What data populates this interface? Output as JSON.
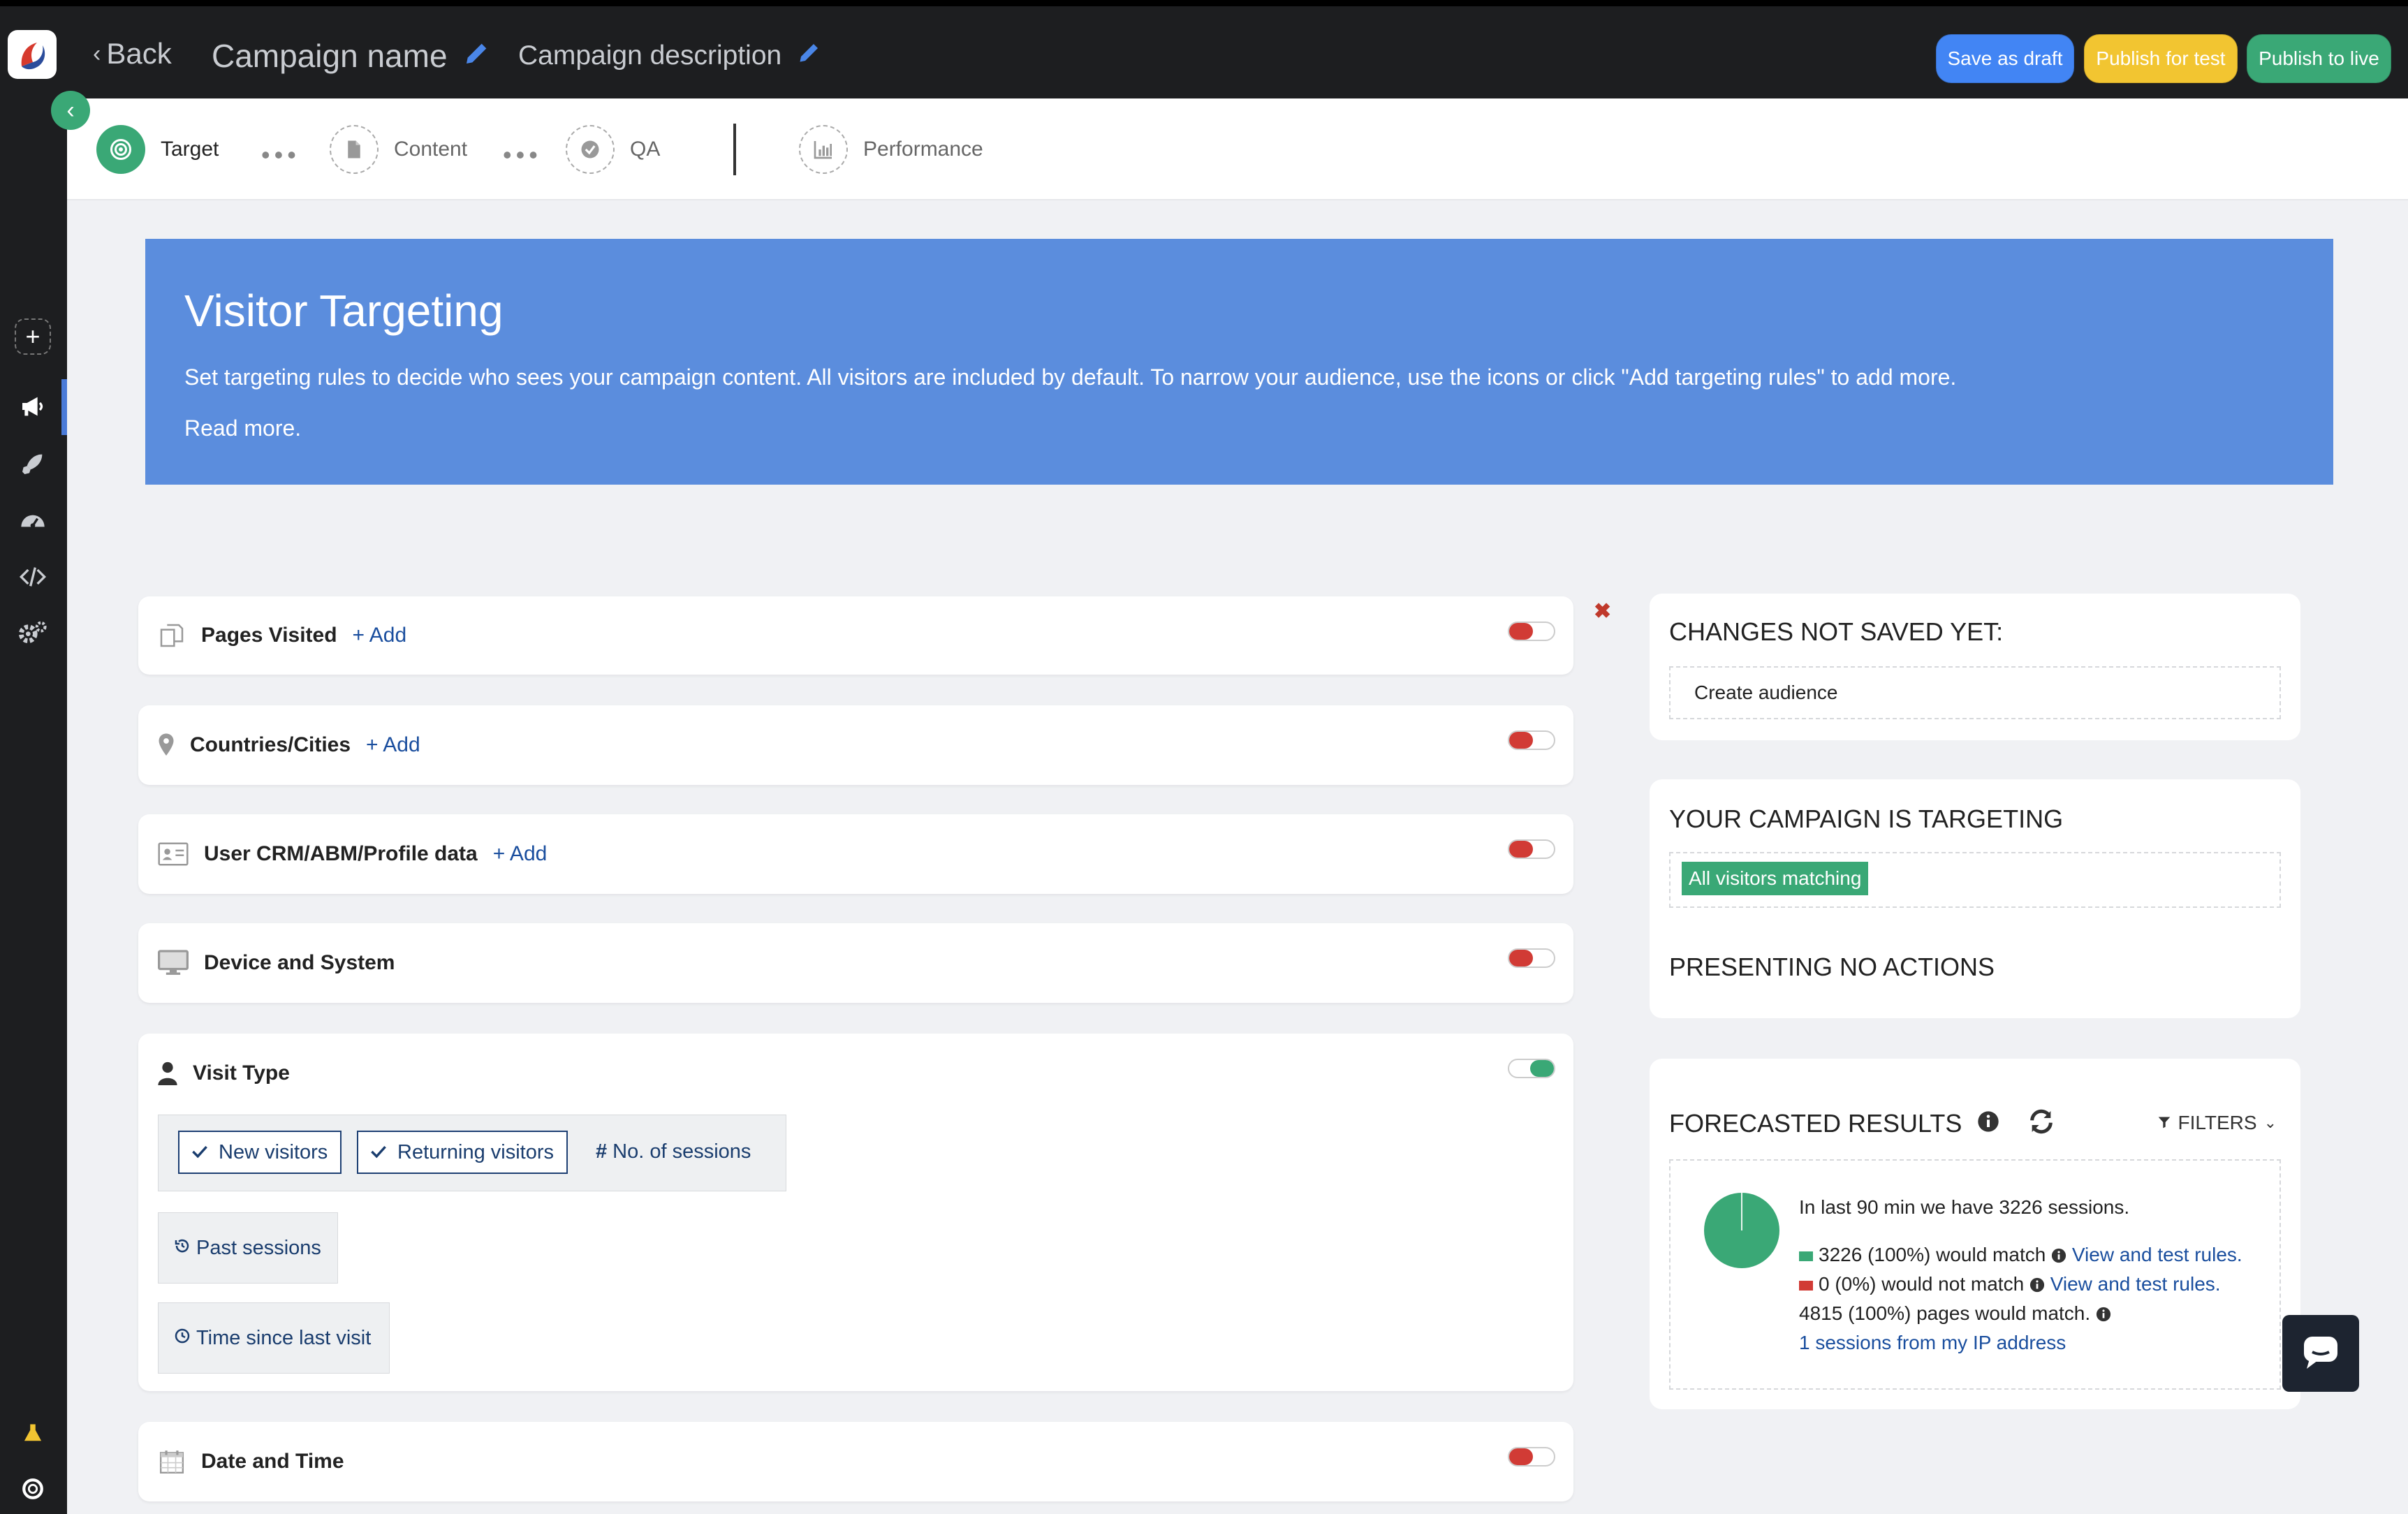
{
  "header": {
    "back_label": "Back",
    "campaign_name": "Campaign name",
    "campaign_description": "Campaign description",
    "buttons": {
      "save_draft": "Save as draft",
      "publish_test": "Publish for test",
      "publish_live": "Publish to live"
    }
  },
  "stepper": {
    "steps": [
      {
        "label": "Target",
        "icon": "target-icon",
        "active": true
      },
      {
        "label": "Content",
        "icon": "document-icon"
      },
      {
        "label": "QA",
        "icon": "check-icon"
      },
      {
        "label": "Performance",
        "icon": "bar-chart-icon"
      }
    ]
  },
  "banner": {
    "title": "Visitor Targeting",
    "body": "Set targeting rules to decide who sees your campaign content. All visitors are included by default. To narrow your audience, use the icons or click \"Add targeting rules\" to add more.",
    "read_more": "Read more."
  },
  "rules": {
    "add_label": "+ Add",
    "pages_visited": "Pages Visited",
    "countries": "Countries/Cities",
    "crm": "User CRM/ABM/Profile data",
    "device": "Device and System",
    "visit_type": "Visit Type",
    "date_time": "Date and Time",
    "visit_options": {
      "new_visitors": "New visitors",
      "returning_visitors": "Returning visitors",
      "no_sessions": "No. of sessions",
      "past_sessions": "Past sessions",
      "time_since": "Time since last visit"
    }
  },
  "right": {
    "changes_title": "CHANGES NOT SAVED YET:",
    "changes_item": "Create audience",
    "targeting_title": "YOUR CAMPAIGN IS TARGETING",
    "targeting_badge": "All visitors matching",
    "presenting": "PRESENTING NO ACTIONS",
    "forecast_title": "FORECASTED RESULTS",
    "filters_label": "FILTERS",
    "forecast": {
      "line1": "In last 90 min we have 3226 sessions.",
      "match_text": "3226 (100%) would match",
      "nomatch_text": "0 (0%) would not match",
      "view_rules": "View and test rules.",
      "pages_text": "4815 (100%) pages would match.",
      "ip_link": "1 sessions from my IP address"
    },
    "pie": {
      "match_pct": 100,
      "nomatch_pct": 0
    }
  },
  "colors": {
    "accent_green": "#3aa876",
    "banner_blue": "#5b8ddd",
    "draft_blue": "#4285f4",
    "test_yellow": "#f2c531",
    "toggle_red": "#d13b35"
  }
}
